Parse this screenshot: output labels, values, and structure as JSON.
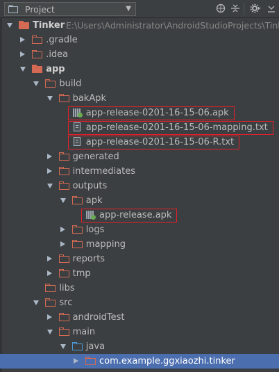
{
  "toolbar": {
    "view_selector": "Project",
    "icons": [
      "globe-icon",
      "collapse-icon",
      "gear-icon",
      "hide-icon"
    ]
  },
  "tree": [
    {
      "name": "root-tinker",
      "label": "Tinker",
      "path": "E:\\Users\\Administrator\\AndroidStudioProjects\\Tinker",
      "depth": 0,
      "arrow": "down",
      "icon": "folder-module",
      "bold": true
    },
    {
      "name": "gradle",
      "label": ".gradle",
      "depth": 1,
      "arrow": "right",
      "icon": "folder"
    },
    {
      "name": "idea",
      "label": ".idea",
      "depth": 1,
      "arrow": "right",
      "icon": "folder"
    },
    {
      "name": "app",
      "label": "app",
      "depth": 1,
      "arrow": "down",
      "icon": "folder-module",
      "bold": true
    },
    {
      "name": "build",
      "label": "build",
      "depth": 2,
      "arrow": "down",
      "icon": "folder"
    },
    {
      "name": "bakapk",
      "label": "bakApk",
      "depth": 3,
      "arrow": "down",
      "icon": "folder"
    },
    {
      "name": "bak-apk-file",
      "label": "app-release-0201-16-15-06.apk",
      "depth": 4,
      "icon": "apk",
      "highlight": true
    },
    {
      "name": "bak-mapping-file",
      "label": "app-release-0201-16-15-06-mapping.txt",
      "depth": 4,
      "icon": "file",
      "highlight": true
    },
    {
      "name": "bak-r-file",
      "label": "app-release-0201-16-15-06-R.txt",
      "depth": 4,
      "icon": "file",
      "highlight": true
    },
    {
      "name": "generated",
      "label": "generated",
      "depth": 3,
      "arrow": "right",
      "icon": "folder"
    },
    {
      "name": "intermediates",
      "label": "intermediates",
      "depth": 3,
      "arrow": "right",
      "icon": "folder"
    },
    {
      "name": "outputs",
      "label": "outputs",
      "depth": 3,
      "arrow": "down",
      "icon": "folder"
    },
    {
      "name": "apk",
      "label": "apk",
      "depth": 4,
      "arrow": "down",
      "icon": "folder"
    },
    {
      "name": "release-apk-file",
      "label": "app-release.apk",
      "depth": 5,
      "icon": "apk",
      "highlight": true
    },
    {
      "name": "logs",
      "label": "logs",
      "depth": 4,
      "arrow": "right",
      "icon": "folder"
    },
    {
      "name": "mapping",
      "label": "mapping",
      "depth": 4,
      "arrow": "right",
      "icon": "folder"
    },
    {
      "name": "reports",
      "label": "reports",
      "depth": 3,
      "arrow": "right",
      "icon": "folder"
    },
    {
      "name": "tmp",
      "label": "tmp",
      "depth": 3,
      "arrow": "right",
      "icon": "folder"
    },
    {
      "name": "libs",
      "label": "libs",
      "depth": 2,
      "icon": "folder"
    },
    {
      "name": "src",
      "label": "src",
      "depth": 2,
      "arrow": "down",
      "icon": "folder"
    },
    {
      "name": "androidtest",
      "label": "androidTest",
      "depth": 3,
      "arrow": "right",
      "icon": "folder"
    },
    {
      "name": "main",
      "label": "main",
      "depth": 3,
      "arrow": "down",
      "icon": "folder"
    },
    {
      "name": "java",
      "label": "java",
      "depth": 4,
      "arrow": "down",
      "icon": "folder-blue"
    },
    {
      "name": "package",
      "label": "com.example.ggxiaozhi.tinker",
      "depth": 5,
      "arrow": "right",
      "icon": "folder",
      "selected": true
    }
  ]
}
